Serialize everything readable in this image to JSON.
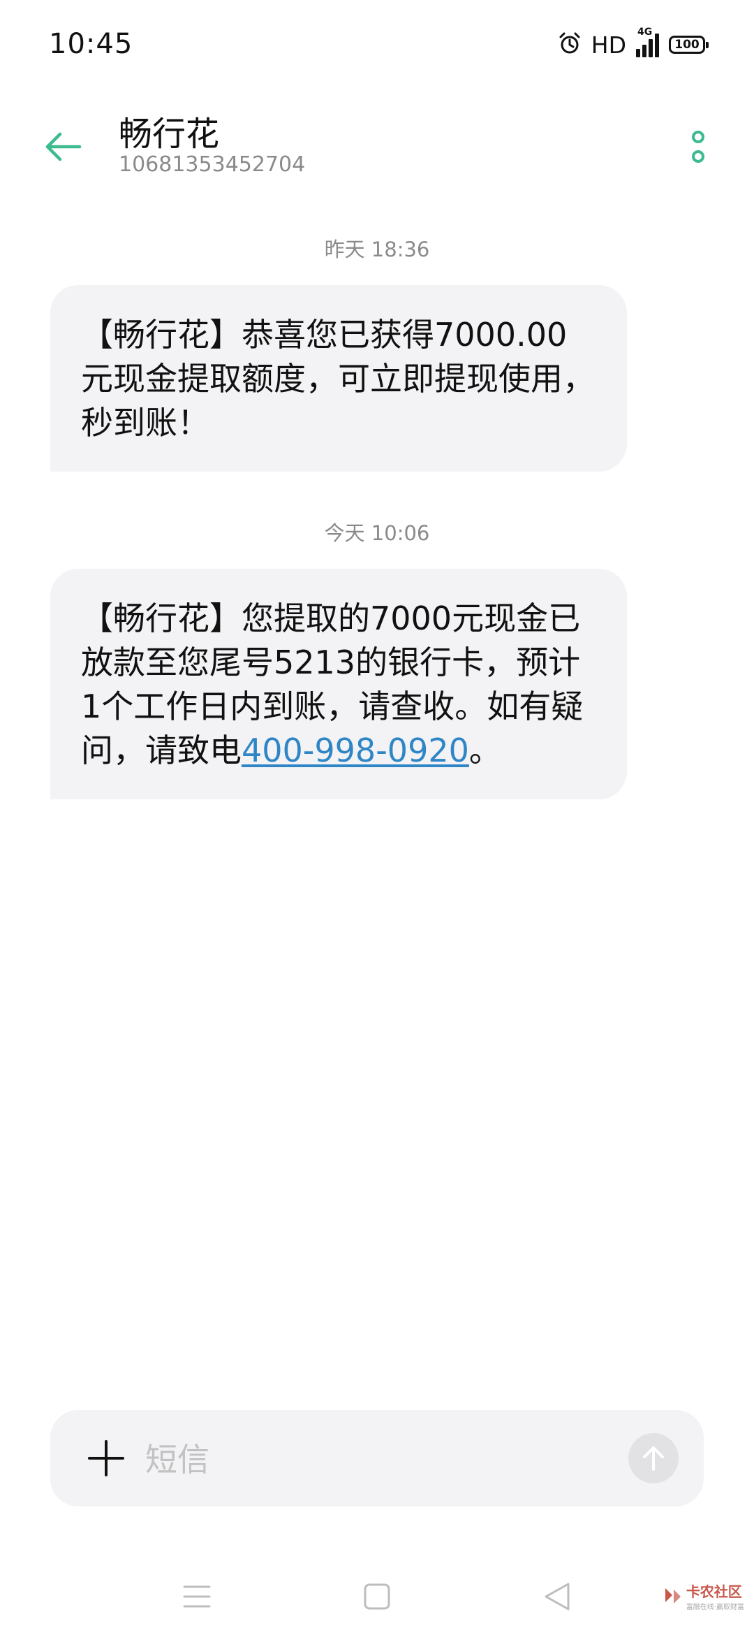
{
  "status_bar": {
    "time": "10:45",
    "hd": "HD",
    "network": "4G",
    "battery": "100"
  },
  "header": {
    "contact_name": "畅行花",
    "contact_number": "10681353452704"
  },
  "messages": [
    {
      "timestamp": "昨天 18:36",
      "text": "【畅行花】恭喜您已获得7000.00元现金提取额度，可立即提现使用，秒到账！"
    },
    {
      "timestamp": "今天 10:06",
      "text_before_link": "【畅行花】您提取的7000元现金已放款至您尾号5213的银行卡，预计1个工作日内到账，请查收。如有疑问，请致电",
      "link": "400-998-0920",
      "text_after_link": "。"
    }
  ],
  "composer": {
    "placeholder": "短信"
  },
  "watermark": {
    "main": "卡农社区",
    "sub": "富融在线·赢取财富"
  },
  "icons": {
    "back": "arrow-left-icon",
    "more": "more-vertical-icon",
    "plus": "plus-icon",
    "send": "arrow-up-icon",
    "alarm": "alarm-icon",
    "menu": "menu-icon",
    "home": "home-square-icon",
    "back_nav": "triangle-back-icon"
  },
  "colors": {
    "accent": "#3dbb8e",
    "link": "#2f86c7",
    "bubble": "#f3f3f5",
    "secondary_text": "#8a8a8a",
    "placeholder": "#c2c2c2"
  }
}
